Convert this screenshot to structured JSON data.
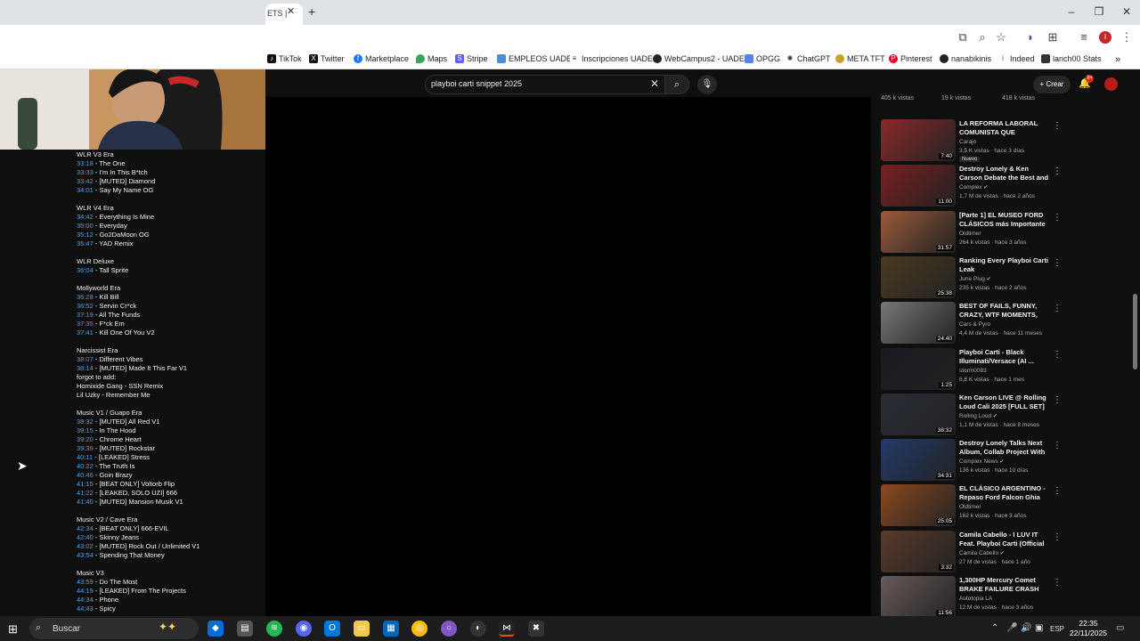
{
  "browser": {
    "active_tab_title": "ETS |",
    "bookmarks": [
      "TikTok",
      "Twitter",
      "Marketplace",
      "Maps",
      "Stripe",
      "EMPLEOS UADE",
      "Inscripciones UADE",
      "WebCampus2 - UADE",
      "OPGG",
      "ChatGPT",
      "META TFT",
      "Pinterest",
      "nanabikinis",
      "Indeed",
      "lanch00 Stats"
    ],
    "profile_initial": "I"
  },
  "youtube": {
    "search_query": "playboi carti snippet 2025",
    "create_label": "Crear",
    "notif_count": "9+"
  },
  "description_lines": [
    {
      "t": "",
      "x": "WLR V3 Era"
    },
    {
      "t": "33:18",
      "x": " - The One"
    },
    {
      "t": "33:33",
      "x": " - I'm In This B*tch"
    },
    {
      "t": "33:42",
      "x": " - [MUTED] Diamond"
    },
    {
      "t": "34:01",
      "x": " - Say My Name OG"
    },
    {
      "gap": true
    },
    {
      "t": "",
      "x": "WLR V4 Era"
    },
    {
      "t": "34:42",
      "x": " - Everything Is Mine"
    },
    {
      "t": "35:00",
      "x": " - Everyday"
    },
    {
      "t": "35:12",
      "x": " - Go2DaMoon OG"
    },
    {
      "t": "35:47",
      "x": " - YAD Remix"
    },
    {
      "gap": true
    },
    {
      "t": "",
      "x": "WLR Deluxe"
    },
    {
      "t": "36:04",
      "x": " - Tall Sprite"
    },
    {
      "gap": true
    },
    {
      "t": "",
      "x": "Mollyworld Era"
    },
    {
      "t": "36:28",
      "x": " - Kill Bill"
    },
    {
      "t": "36:52",
      "x": " - Servin Cr*ck"
    },
    {
      "t": "37:19",
      "x": " - All The Funds"
    },
    {
      "t": "37:35",
      "x": " - F*ck Em"
    },
    {
      "t": "37:41",
      "x": " - Kill One Of You V2"
    },
    {
      "gap": true
    },
    {
      "t": "",
      "x": "Narcissist Era"
    },
    {
      "t": "38:07",
      "x": " - Different Vibes"
    },
    {
      "t": "38:14",
      "x": " - [MUTED] Made It This Far V1"
    },
    {
      "t": "",
      "x": "forgot to add:"
    },
    {
      "t": "",
      "x": "Homixide Gang - SSN Remix"
    },
    {
      "t": "",
      "x": "Lil Uzky - Remember Me"
    },
    {
      "gap": true
    },
    {
      "t": "",
      "x": "Music V1 / Guapo Era"
    },
    {
      "t": "38:32",
      "x": " - [MUTED] All Red V1"
    },
    {
      "t": "39:15",
      "x": " - In The Hood"
    },
    {
      "t": "39:20",
      "x": " - Chrome Heart"
    },
    {
      "t": "39:39",
      "x": " - [MUTED] Rockstar"
    },
    {
      "t": "40:11",
      "x": " - [LEAKED] Stress"
    },
    {
      "t": "40:22",
      "x": " - The Truth Is"
    },
    {
      "t": "40:46",
      "x": " - Goin Brazy"
    },
    {
      "t": "41:15",
      "x": " - [BEAT ONLY] Voltorb Flip"
    },
    {
      "t": "41:22",
      "x": " - [LEAKED, SOLO UZI] 666"
    },
    {
      "t": "41:40",
      "x": " - [MUTED] Mansion Musik V1"
    },
    {
      "gap": true
    },
    {
      "t": "",
      "x": "Music V2 / Cave Era"
    },
    {
      "t": "42:34",
      "x": " - [BEAT ONLY] 666-EVIL"
    },
    {
      "t": "42:40",
      "x": " - Skinny Jeans"
    },
    {
      "t": "43:02",
      "x": " - [MUTED] Rock Out / Unlimited V1"
    },
    {
      "t": "43:54",
      "x": " - Spending That Money"
    },
    {
      "gap": true
    },
    {
      "t": "",
      "x": "Music V3"
    },
    {
      "t": "43:59",
      "x": " - Do The Most"
    },
    {
      "t": "44:19",
      "x": " - [LEAKED] From The Projects"
    },
    {
      "t": "44:34",
      "x": " - Phone"
    },
    {
      "t": "44:43",
      "x": " - Spicy"
    }
  ],
  "top_views": [
    "405 k vistas",
    "19 k vistas",
    "418 k vistas"
  ],
  "videos": [
    {
      "title": "LA REFORMA LABORAL COMUNISTA QUE PROPONE E...",
      "channel": "Carajo",
      "meta": "3,5 K vistas · hace 3 días",
      "dur": "7:40",
      "badge": "Nuevo",
      "verified": false,
      "color": "#8b2a2a"
    },
    {
      "title": "Destroy Lonely & Ken Carson Debate the Best and Worst ...",
      "channel": "Complex",
      "meta": "1,7 M de vistas · hace 2 años",
      "dur": "11:00",
      "verified": true,
      "color": "#7a1f1f"
    },
    {
      "title": "[Parte 1] EL MUSEO FORD CLÁSICOS más Importante de ...",
      "channel": "Oldtimer",
      "meta": "264 k vistas · hace 3 años",
      "dur": "31:57",
      "verified": false,
      "color": "#9a5a3a"
    },
    {
      "title": "Ranking Every Playboi Carti Leak",
      "channel": "June Plug",
      "meta": "235 k vistas · hace 2 años",
      "dur": "25:38",
      "verified": true,
      "color": "#4a3a20"
    },
    {
      "title": "BEST OF FAILS, FUNNY, CRAZY, WTF MOMENTS, CLOSE CALL...",
      "channel": "Cars & Pyro",
      "meta": "4,4 M de vistas · hace 11 meses",
      "dur": "24:40",
      "verified": false,
      "color": "#777"
    },
    {
      "title": "Playboi Carti - Black Illuminati/Versace (AI ...",
      "channel": "storm0083",
      "meta": "6,8 K vistas · hace 1 mes",
      "dur": "1:25",
      "verified": false,
      "color": "#1a1a22"
    },
    {
      "title": "Ken Carson LIVE @ Rolling Loud Cali 2025 [FULL SET]",
      "channel": "Rolling Loud",
      "meta": "1,1 M de vistas · hace 8 meses",
      "dur": "38:32",
      "verified": true,
      "color": "#2a2d38"
    },
    {
      "title": "Destroy Lonely Talks Next Album, Collab Project With Ke...",
      "channel": "Complex News",
      "meta": "136 k vistas · hace 10 días",
      "dur": "34:31",
      "verified": true,
      "color": "#223b6a"
    },
    {
      "title": "EL CLÁSICO ARGENTINO - Repaso Ford Falcon Ghia 1983...",
      "channel": "Oldtimer",
      "meta": "162 k vistas · hace 3 años",
      "dur": "25:05",
      "verified": false,
      "color": "#8a4a20"
    },
    {
      "title": "Camila Cabello - I LUV IT Feat. Playboi Carti (Official Music ...",
      "channel": "Camila Cabello",
      "meta": "27 M de vistas · hace 1 año",
      "dur": "3:32",
      "verified": true,
      "color": "#5a3a2a"
    },
    {
      "title": "1,300HP Mercury Comet BRAKE FAILURE CRASH",
      "channel": "Autotopia LA",
      "meta": "12 M de vistas · hace 3 años",
      "dur": "11:56",
      "verified": false,
      "color": "#6a5a5a"
    }
  ],
  "taskbar": {
    "search_placeholder": "Buscar",
    "lang": "ESP",
    "time": "22:35",
    "date": "22/11/2025"
  }
}
